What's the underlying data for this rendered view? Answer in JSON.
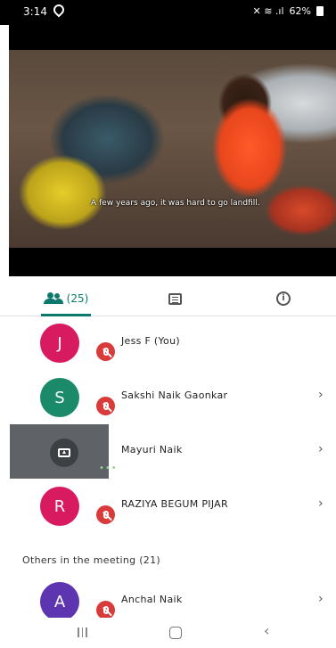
{
  "status_bar": {
    "time": "3:14",
    "right_text": "62%"
  },
  "video": {
    "caption": "A few years ago, it was hard to go landfill."
  },
  "tabs": {
    "people_label": "(25)"
  },
  "participants": [
    {
      "initial": "J",
      "name": "Jess F (You)",
      "color": "#d81b60",
      "muted": true,
      "chevron": ""
    },
    {
      "initial": "S",
      "name": "Sakshi Naik Gaonkar",
      "color": "#1b8a6b",
      "muted": true,
      "chevron": "›"
    },
    {
      "initial": "",
      "name": "Mayuri Naik",
      "color": "#5f6368",
      "presenting": true,
      "dots": "•••",
      "chevron": "›"
    },
    {
      "initial": "R",
      "name": "RAZIYA BEGUM PIJAR",
      "color": "#d81b60",
      "muted": true,
      "chevron": "›"
    }
  ],
  "others_section": {
    "title": "Others in the meeting (21)"
  },
  "others": [
    {
      "initial": "A",
      "name": "Anchal Naik",
      "color": "#5e35b1",
      "muted": true,
      "chevron": "›"
    }
  ],
  "nav": {
    "back": "‹"
  }
}
